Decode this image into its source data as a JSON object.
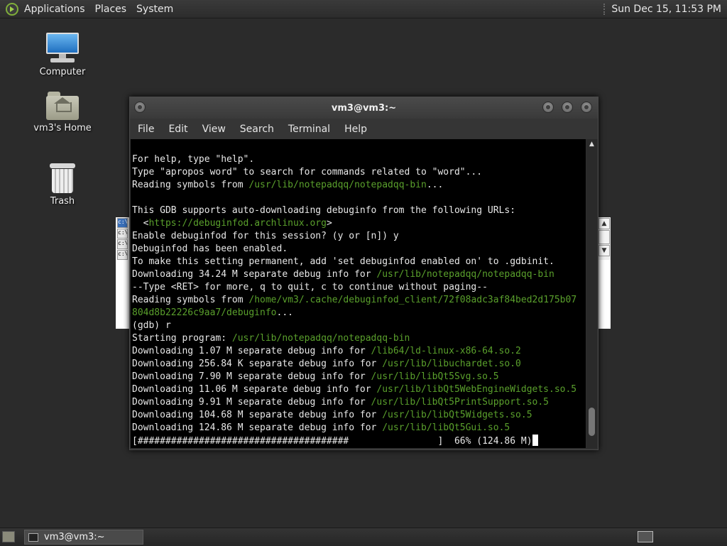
{
  "top_panel": {
    "menus": [
      "Applications",
      "Places",
      "System"
    ],
    "clock": "Sun Dec 15, 11:53 PM"
  },
  "desktop_icons": [
    {
      "label": "Computer",
      "icon": "computer-icon"
    },
    {
      "label": "vm3's Home",
      "icon": "home-folder-icon"
    },
    {
      "label": "Trash",
      "icon": "trash-icon"
    }
  ],
  "background_window": {
    "items": [
      "c:\\",
      "c:\\",
      "c:\\",
      "c:\\"
    ]
  },
  "terminal_window": {
    "title": "vm3@vm3:~",
    "menu": [
      "File",
      "Edit",
      "View",
      "Search",
      "Terminal",
      "Help"
    ],
    "lines": [
      [
        {
          "t": "For help, type \"help\"."
        }
      ],
      [
        {
          "t": "Type \"apropos word\" to search for commands related to \"word\"..."
        }
      ],
      [
        {
          "t": "Reading symbols from "
        },
        {
          "t": "/usr/lib/notepadqq/notepadqq-bin",
          "p": true
        },
        {
          "t": "..."
        }
      ],
      [
        {
          "t": ""
        }
      ],
      [
        {
          "t": "This GDB supports auto-downloading debuginfo from the following URLs:"
        }
      ],
      [
        {
          "t": "  <"
        },
        {
          "t": "https://debuginfod.archlinux.org",
          "p": true
        },
        {
          "t": ">"
        }
      ],
      [
        {
          "t": "Enable debuginfod for this session? (y or [n]) y"
        }
      ],
      [
        {
          "t": "Debuginfod has been enabled."
        }
      ],
      [
        {
          "t": "To make this setting permanent, add 'set debuginfod enabled on' to .gdbinit."
        }
      ],
      [
        {
          "t": "Downloading 34.24 M separate debug info for "
        },
        {
          "t": "/usr/lib/notepadqq/notepadqq-bin",
          "p": true
        }
      ],
      [
        {
          "t": "--Type <RET> for more, q to quit, c to continue without paging--"
        }
      ],
      [
        {
          "t": "Reading symbols from "
        },
        {
          "t": "/home/vm3/.cache/debuginfod_client/72f08adc3af84bed2d175b07",
          "p": true
        }
      ],
      [
        {
          "t": "804d8b22226c9aa7/debuginfo",
          "p": true
        },
        {
          "t": "..."
        }
      ],
      [
        {
          "t": "(gdb) r"
        }
      ],
      [
        {
          "t": "Starting program: "
        },
        {
          "t": "/usr/lib/notepadqq/notepadqq-bin",
          "p": true
        }
      ],
      [
        {
          "t": "Downloading 1.07 M separate debug info for "
        },
        {
          "t": "/lib64/ld-linux-x86-64.so.2",
          "p": true
        }
      ],
      [
        {
          "t": "Downloading 256.84 K separate debug info for "
        },
        {
          "t": "/usr/lib/libuchardet.so.0",
          "p": true
        }
      ],
      [
        {
          "t": "Downloading 7.90 M separate debug info for "
        },
        {
          "t": "/usr/lib/libQt5Svg.so.5",
          "p": true
        }
      ],
      [
        {
          "t": "Downloading 11.06 M separate debug info for "
        },
        {
          "t": "/usr/lib/libQt5WebEngineWidgets.so.5",
          "p": true
        }
      ],
      [
        {
          "t": "Downloading 9.91 M separate debug info for "
        },
        {
          "t": "/usr/lib/libQt5PrintSupport.so.5",
          "p": true
        }
      ],
      [
        {
          "t": "Downloading 104.68 M separate debug info for "
        },
        {
          "t": "/usr/lib/libQt5Widgets.so.5",
          "p": true
        }
      ],
      [
        {
          "t": "Downloading 124.86 M separate debug info for "
        },
        {
          "t": "/usr/lib/libQt5Gui.so.5",
          "p": true
        }
      ],
      [
        {
          "t": "[######################################                ]  66% (124.86 M)"
        }
      ]
    ]
  },
  "bottom_panel": {
    "task_label": "vm3@vm3:~"
  },
  "colors": {
    "path_green": "#5aa02c",
    "terminal_bg": "#000000",
    "desktop_bg": "#2b2b2b"
  }
}
